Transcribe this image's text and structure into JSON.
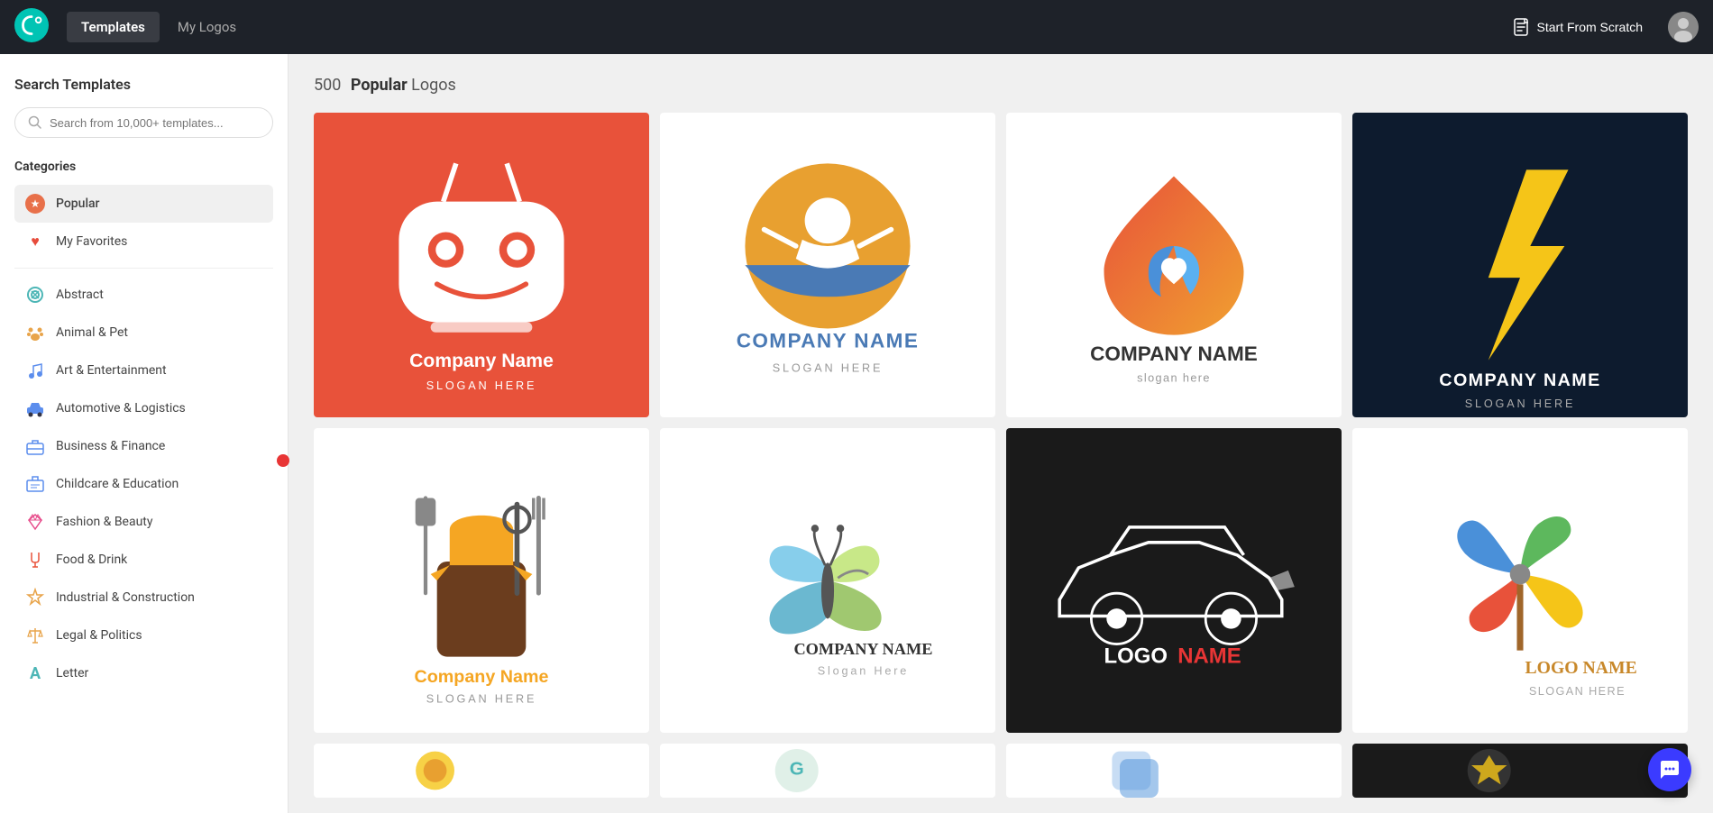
{
  "header": {
    "nav_templates": "Templates",
    "nav_logos": "My Logos",
    "start_scratch": "Start From Scratch"
  },
  "sidebar": {
    "section_title": "Search Templates",
    "search_placeholder": "Search from 10,000+ templates...",
    "categories_title": "Categories",
    "categories": [
      {
        "id": "popular",
        "label": "Popular",
        "icon": "★",
        "type": "star",
        "active": true
      },
      {
        "id": "favorites",
        "label": "My Favorites",
        "icon": "♥",
        "type": "heart",
        "active": false
      },
      {
        "id": "abstract",
        "label": "Abstract",
        "icon": "◎",
        "type": "abstract"
      },
      {
        "id": "animal",
        "label": "Animal & Pet",
        "icon": "🐾",
        "type": "paw"
      },
      {
        "id": "art",
        "label": "Art & Entertainment",
        "icon": "♪",
        "type": "music"
      },
      {
        "id": "auto",
        "label": "Automotive & Logistics",
        "icon": "🚗",
        "type": "car"
      },
      {
        "id": "business",
        "label": "Business & Finance",
        "icon": "💼",
        "type": "briefcase"
      },
      {
        "id": "childcare",
        "label": "Childcare & Education",
        "icon": "🎓",
        "type": "education"
      },
      {
        "id": "fashion",
        "label": "Fashion & Beauty",
        "icon": "💎",
        "type": "diamond"
      },
      {
        "id": "food",
        "label": "Food & Drink",
        "icon": "🍽",
        "type": "food"
      },
      {
        "id": "industrial",
        "label": "Industrial & Construction",
        "icon": "⚠",
        "type": "industrial"
      },
      {
        "id": "legal",
        "label": "Legal & Politics",
        "icon": "⚖",
        "type": "legal"
      },
      {
        "id": "letter",
        "label": "Letter",
        "icon": "A",
        "type": "letter"
      }
    ]
  },
  "content": {
    "count": "500",
    "highlight": "Popular",
    "type": "Logos"
  },
  "cards": [
    {
      "id": 1,
      "bg": "red",
      "style": "card-red"
    },
    {
      "id": 2,
      "bg": "white",
      "style": "card-white"
    },
    {
      "id": 3,
      "bg": "white",
      "style": "card-white"
    },
    {
      "id": 4,
      "bg": "dark-navy",
      "style": "card-dark-navy"
    },
    {
      "id": 5,
      "bg": "white",
      "style": "card-white"
    },
    {
      "id": 6,
      "bg": "white",
      "style": "card-white"
    },
    {
      "id": 7,
      "bg": "black",
      "style": "card-black"
    },
    {
      "id": 8,
      "bg": "white",
      "style": "card-white"
    },
    {
      "id": 9,
      "bg": "white",
      "style": "card-white"
    },
    {
      "id": 10,
      "bg": "white",
      "style": "card-white"
    },
    {
      "id": 11,
      "bg": "white",
      "style": "card-white"
    },
    {
      "id": 12,
      "bg": "dark",
      "style": "card-dark-last"
    }
  ]
}
